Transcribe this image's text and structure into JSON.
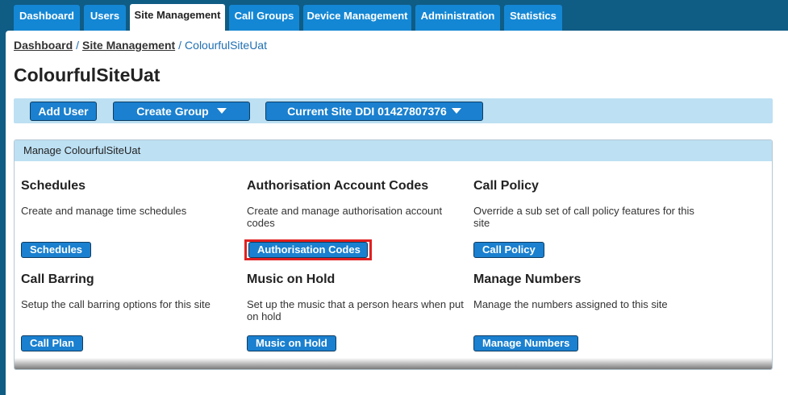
{
  "tabs": [
    {
      "label": "Dashboard"
    },
    {
      "label": "Users"
    },
    {
      "label": "Site Management",
      "active": true
    },
    {
      "label": "Call Groups"
    },
    {
      "label": "Device Management"
    },
    {
      "label": "Administration"
    },
    {
      "label": "Statistics"
    }
  ],
  "breadcrumb": {
    "dashboard": "Dashboard",
    "sep1": "/",
    "site_management": "Site Management",
    "sep2": "/",
    "current": "ColourfulSiteUat"
  },
  "page_title": "ColourfulSiteUat",
  "toolbar": {
    "add_user": "Add User",
    "create_group": "Create Group",
    "current_site": "Current Site DDI 01427807376"
  },
  "manage": {
    "header": "Manage ColourfulSiteUat",
    "cards": [
      {
        "title": "Schedules",
        "desc": "Create and manage time schedules",
        "button": "Schedules"
      },
      {
        "title": "Authorisation Account Codes",
        "desc": "Create and manage authorisation account codes",
        "button": "Authorisation Codes",
        "highlighted": true
      },
      {
        "title": "Call Policy",
        "desc": "Override a sub set of call policy features for this site",
        "button": "Call Policy"
      },
      {
        "title": "Call Barring",
        "desc": "Setup the call barring options for this site",
        "button": "Call Plan"
      },
      {
        "title": "Music on Hold",
        "desc": "Set up the music that a person hears when put on hold",
        "button": "Music on Hold"
      },
      {
        "title": "Manage Numbers",
        "desc": "Manage the numbers assigned to this site",
        "button": "Manage Numbers"
      }
    ]
  },
  "colors": {
    "background": "#0f5c85",
    "tab": "#1487d4",
    "button": "#1a80cf",
    "toolbar": "#bde0f3",
    "highlight": "#e02020"
  }
}
